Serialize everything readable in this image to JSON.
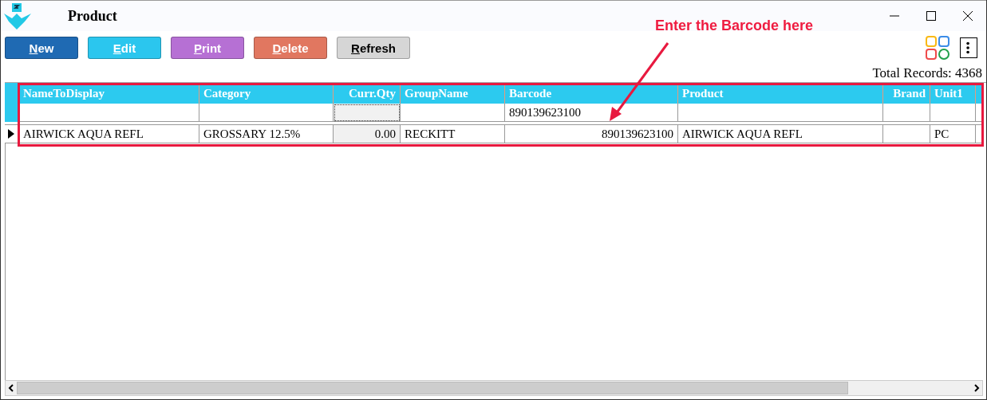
{
  "window": {
    "title": "Product"
  },
  "toolbar": {
    "buttons": [
      {
        "label": "New",
        "color": "#1f6ab3"
      },
      {
        "label": "Edit",
        "color": "#2bc6ee"
      },
      {
        "label": "Print",
        "color": "#b670d4"
      },
      {
        "label": "Delete",
        "color": "#e17760"
      },
      {
        "label": "Refresh",
        "color": "#d6d6d6"
      }
    ]
  },
  "total_records": "Total Records: 4368",
  "table": {
    "columns": [
      {
        "label": "NameToDisplay"
      },
      {
        "label": "Category"
      },
      {
        "label": "Curr.Qty"
      },
      {
        "label": "GroupName"
      },
      {
        "label": "Barcode"
      },
      {
        "label": "Product"
      },
      {
        "label": "Brand"
      },
      {
        "label": "Unit1"
      },
      {}
    ],
    "barcode_filter": "890139623100",
    "rows": [
      {
        "current": true,
        "cells": [
          {
            "text": "AIRWICK AQUA REFL"
          },
          {
            "text": "GROSSARY 12.5%"
          },
          {
            "text": "0.00"
          },
          {
            "text": "RECKITT"
          },
          {
            "text": "890139623100"
          },
          {
            "text": "AIRWICK AQUA REFL"
          },
          {},
          {
            "text": "PC"
          },
          {}
        ]
      }
    ]
  },
  "annotation": {
    "text": "Enter the Barcode here"
  }
}
